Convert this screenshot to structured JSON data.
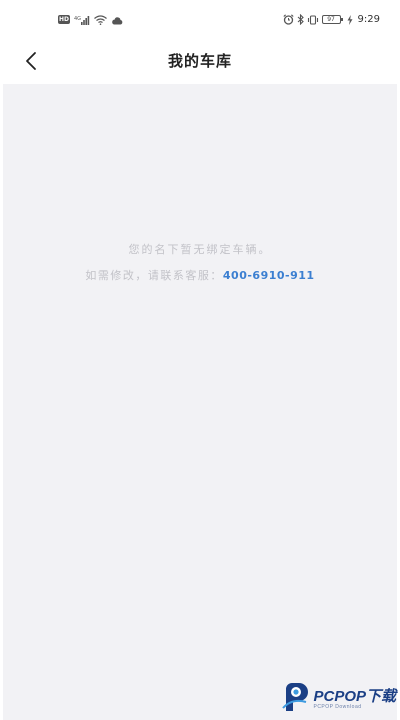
{
  "status_bar": {
    "hd": "HD",
    "battery_level": "97",
    "time": "9:29",
    "icons": [
      "hd-icon",
      "signal-icon",
      "wifi-icon",
      "cloud-icon",
      "alarm-icon",
      "bluetooth-icon",
      "vibrate-icon",
      "battery-icon",
      "charging-icon"
    ]
  },
  "header": {
    "title": "我的车库",
    "back_icon": "chevron-left-icon"
  },
  "content": {
    "empty_message": "您的名下暂无绑定车辆。",
    "contact_prefix": "如需修改，请联系客服：",
    "phone": "400-6910-911",
    "phone_color": "#3b7fd1"
  },
  "watermark": {
    "brand": "PCPOP下载",
    "sub": "PCPOP Download"
  }
}
